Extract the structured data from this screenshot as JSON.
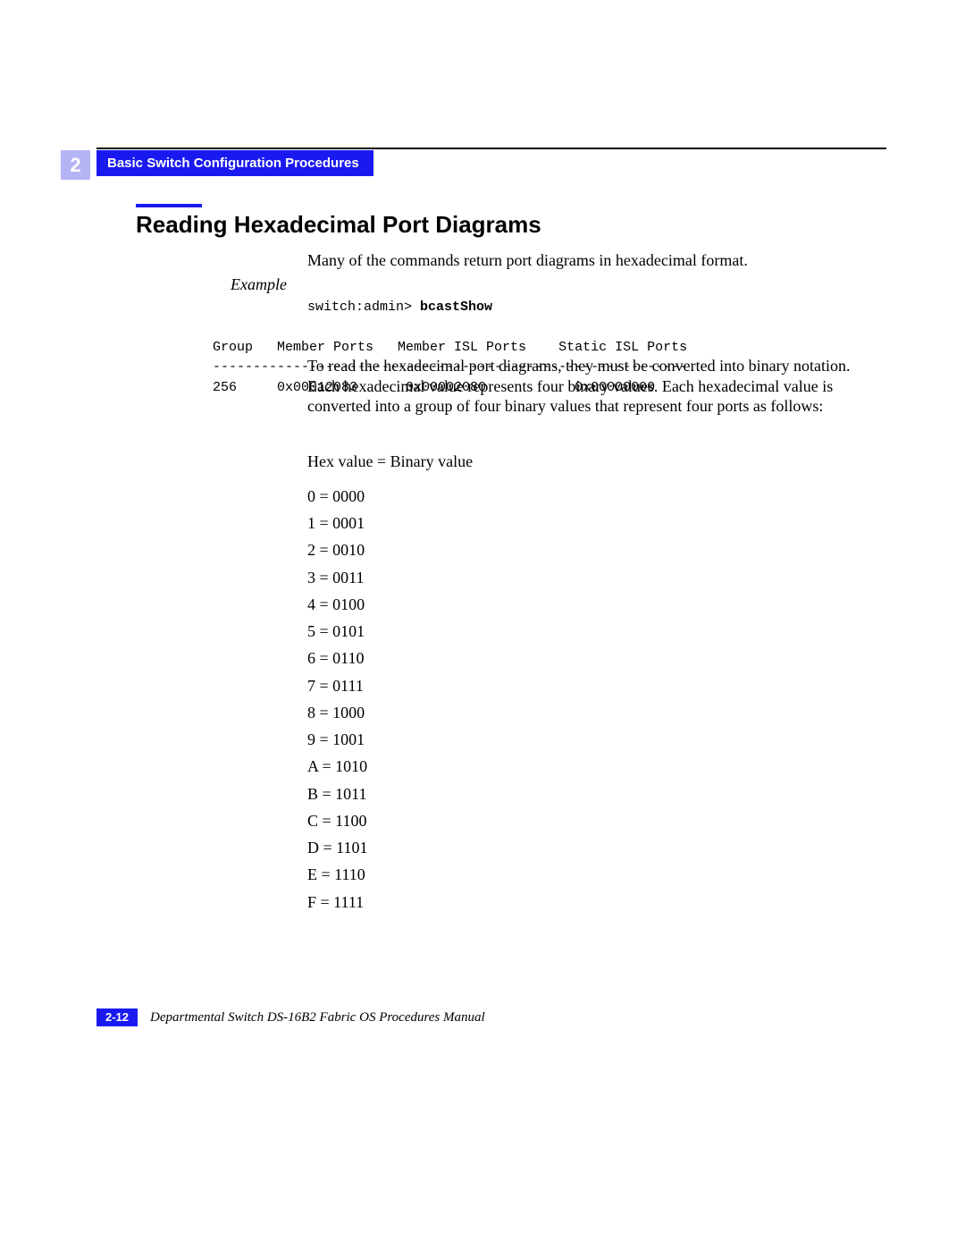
{
  "header": {
    "chapter_tab": "Basic Switch Configuration Procedures",
    "chapter_num": "2"
  },
  "section": {
    "title": "Reading Hexadecimal Port Diagrams"
  },
  "intro": "Many of the commands return port diagrams in hexadecimal format.",
  "example_label": "Example",
  "code": {
    "prompt": "switch:admin> ",
    "cmd": "bcastShow",
    "header_line": "Group   Member Ports   Member ISL Ports    Static ISL Ports",
    "rule_line": "-----------------------------------------------------------",
    "data_line": "256     0x00012083      0x00002080           0x00000000"
  },
  "explain": "To read the hexadecimal port diagrams, they must be converted into binary notation. Each hexadecimal value represents four binary values. Each hexadecimal value is converted into a group of four binary values that represent four ports as follows:",
  "hex_label": "Hex value = Binary value",
  "hex_map": [
    "0 = 0000",
    "1 = 0001",
    "2 = 0010",
    "3 = 0011",
    "4 = 0100",
    "5 = 0101",
    "6 = 0110",
    "7 = 0111",
    "8 = 1000",
    "9 = 1001",
    "A = 1010",
    "B = 1011",
    "C = 1100",
    "D = 1101",
    "E = 1110",
    "F = 1111"
  ],
  "footer": {
    "page": "2-12",
    "title": "Departmental Switch DS-16B2 Fabric OS Procedures Manual"
  }
}
